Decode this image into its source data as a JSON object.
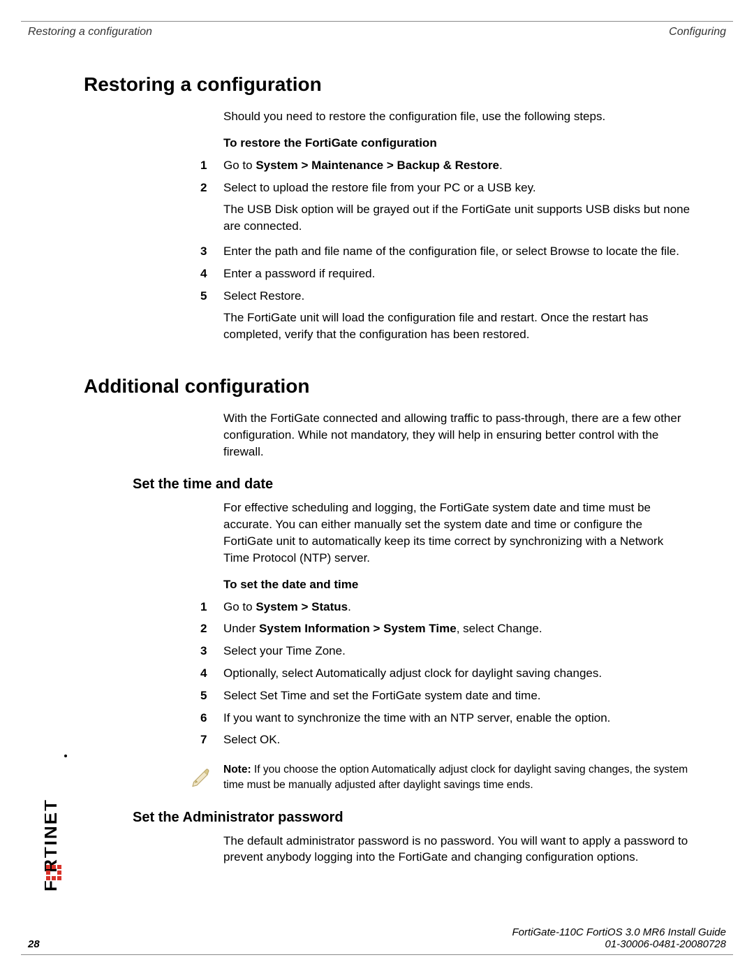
{
  "header": {
    "left": "Restoring a configuration",
    "right": "Configuring"
  },
  "section1": {
    "title": "Restoring a configuration",
    "intro": "Should you need to restore the configuration file, use the following steps.",
    "proc_title": "To restore the FortiGate configuration",
    "steps": [
      {
        "n": "1",
        "prefix": "Go to ",
        "bold": "System > Maintenance > Backup & Restore",
        "suffix": "."
      },
      {
        "n": "2",
        "text": "Select to upload the restore file from your PC or a USB key.",
        "extra": "The USB Disk option will be grayed out if the FortiGate unit supports USB disks but none are connected."
      },
      {
        "n": "3",
        "text": "Enter the path and file name of the configuration file, or select Browse to locate the file."
      },
      {
        "n": "4",
        "text": "Enter a password if required."
      },
      {
        "n": "5",
        "text": "Select Restore.",
        "extra": "The FortiGate unit will load the configuration file and restart. Once the restart has completed, verify that the configuration has been restored."
      }
    ]
  },
  "section2": {
    "title": "Additional configuration",
    "intro": "With the FortiGate connected and allowing traffic to pass-through, there are a few other configuration. While not mandatory, they will help in ensuring better control with the firewall.",
    "sub1": {
      "title": "Set the time and date",
      "intro": "For effective scheduling and logging, the FortiGate system date and time must be accurate. You can either manually set the system date and time or configure the FortiGate unit to automatically keep its time correct by synchronizing with a Network Time Protocol (NTP) server.",
      "proc_title": "To set the date and time",
      "steps": [
        {
          "n": "1",
          "prefix": "Go to ",
          "bold": "System > Status",
          "suffix": "."
        },
        {
          "n": "2",
          "prefix": "Under ",
          "bold": "System Information > System Time",
          "suffix": ", select Change."
        },
        {
          "n": "3",
          "text": "Select your Time Zone."
        },
        {
          "n": "4",
          "text": "Optionally, select Automatically adjust clock for daylight saving changes."
        },
        {
          "n": "5",
          "text": "Select Set Time and set the FortiGate system date and time."
        },
        {
          "n": "6",
          "text": "If you want to synchronize the time with an NTP server, enable the option."
        },
        {
          "n": "7",
          "text": "Select OK."
        }
      ],
      "note_label": "Note:",
      "note_text": " If you choose the option Automatically adjust clock for daylight saving changes, the system time must be manually adjusted after daylight savings time ends."
    },
    "sub2": {
      "title": "Set the Administrator password",
      "intro": "The default administrator password is no password. You will want to apply a password to prevent anybody logging into the FortiGate and changing configuration options."
    }
  },
  "footer": {
    "page": "28",
    "doc_title": "FortiGate-110C FortiOS 3.0 MR6 Install Guide",
    "doc_id": "01-30006-0481-20080728"
  }
}
